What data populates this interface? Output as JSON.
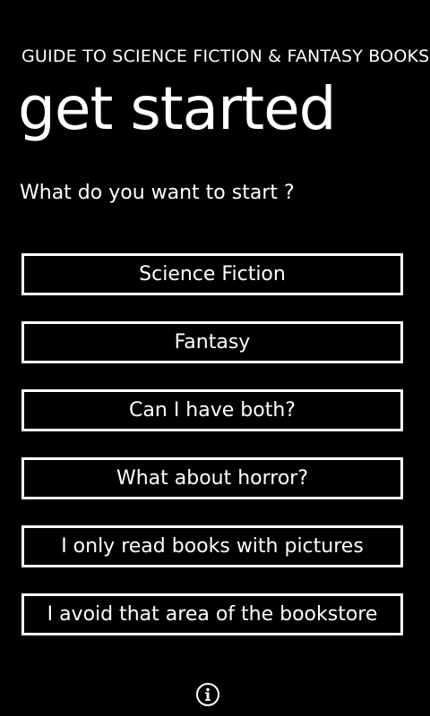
{
  "header": {
    "app_title": "GUIDE TO SCIENCE FICTION & FANTASY BOOKS",
    "page_title": "get started"
  },
  "main": {
    "prompt": "What do you want to start ?",
    "choices": [
      {
        "label": "Science Fiction"
      },
      {
        "label": "Fantasy"
      },
      {
        "label": "Can I have both?"
      },
      {
        "label": "What about horror?"
      },
      {
        "label": "I only read books with pictures"
      },
      {
        "label": "I avoid that area of the bookstore"
      }
    ]
  },
  "appbar": {
    "info_icon": "info-icon"
  },
  "colors": {
    "background": "#000000",
    "foreground": "#ffffff"
  }
}
